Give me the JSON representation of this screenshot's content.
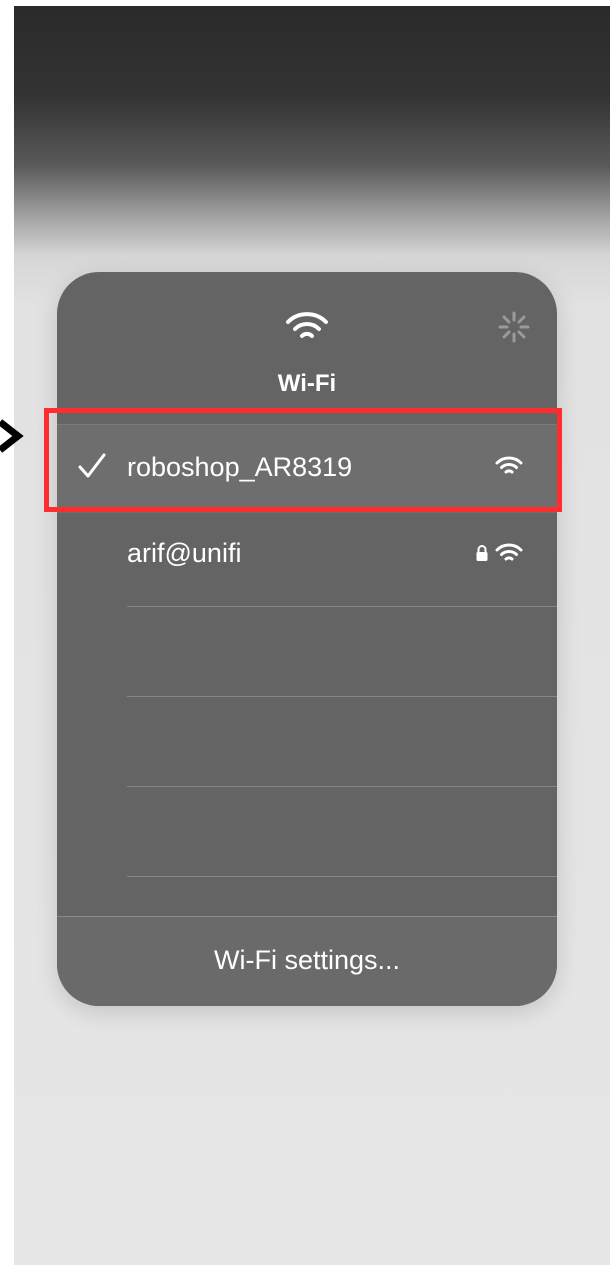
{
  "panel": {
    "title": "Wi-Fi",
    "networks": [
      {
        "name": "roboshop_AR8319",
        "connected": true,
        "secured": false
      },
      {
        "name": "arif@unifi",
        "connected": false,
        "secured": true
      }
    ],
    "settings_label": "Wi-Fi settings..."
  },
  "icons": {
    "header": "wifi-icon",
    "loading": "spinner-icon",
    "connected": "checkmark-icon",
    "signal": "wifi-signal-icon",
    "secured": "lock-icon"
  },
  "colors": {
    "panel": "#646464",
    "highlight": "#ff2d2d",
    "text": "#ffffff"
  }
}
